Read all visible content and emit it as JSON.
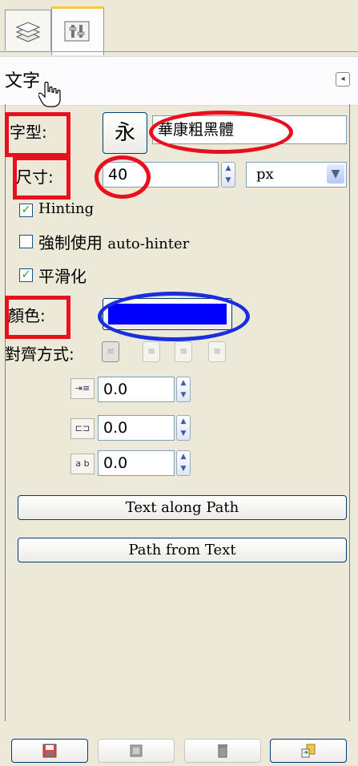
{
  "tabs": [
    {
      "name": "layers-tab",
      "icon": "layers-icon"
    },
    {
      "name": "tool-options-tab",
      "icon": "tool-options-icon",
      "active": true
    }
  ],
  "titlebar": {
    "title": "文字",
    "menu_icon": "◂"
  },
  "font": {
    "label": "字型:",
    "preview": "永",
    "value": "華康粗黑體"
  },
  "size": {
    "label": "尺寸:",
    "value": "40",
    "unit": "px"
  },
  "hinting": {
    "label": "Hinting",
    "checked": true
  },
  "autohinter": {
    "label_prefix": "強制使用 ",
    "label_suffix": "auto-hinter",
    "checked": false
  },
  "antialias": {
    "label": "平滑化",
    "checked": true
  },
  "color": {
    "label": "顏色:",
    "value": "#0000ff"
  },
  "justify": {
    "label": "對齊方式:",
    "options": [
      "left",
      "right",
      "center",
      "fill"
    ],
    "selected": "left"
  },
  "indent": {
    "value": "0.0"
  },
  "line_spacing": {
    "value": "0.0"
  },
  "letter_spacing": {
    "value": "0.0",
    "icon_text": "a b"
  },
  "buttons": {
    "text_along_path": "Text along Path",
    "path_from_text": "Path from Text"
  },
  "bottom_buttons": [
    {
      "name": "save-options-icon",
      "enabled": true
    },
    {
      "name": "restore-options-icon",
      "enabled": false
    },
    {
      "name": "delete-options-icon",
      "enabled": false
    },
    {
      "name": "reset-options-icon",
      "enabled": true
    }
  ],
  "highlight_colors": {
    "red": "#e8101c",
    "blue": "#1a2ee0"
  }
}
